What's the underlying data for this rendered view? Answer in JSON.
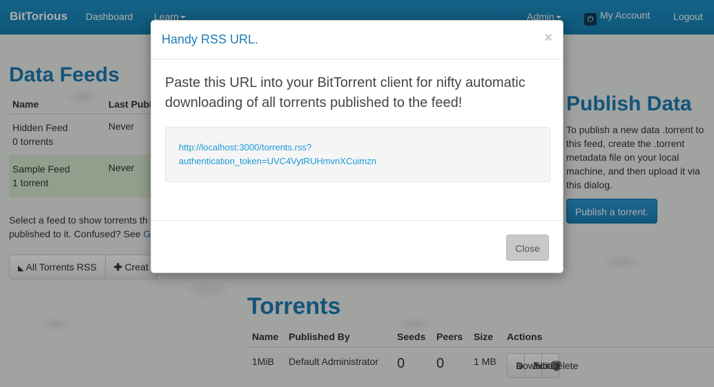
{
  "navbar": {
    "brand": "BitTorious",
    "dashboard": "Dashboard",
    "learn": "Learn",
    "admin": "Admin",
    "my_account": "My Account",
    "logout": "Logout"
  },
  "data_feeds": {
    "title": "Data Feeds",
    "columns": [
      "Name",
      "Last Publ"
    ],
    "rows": [
      {
        "name": "Hidden Feed",
        "count": "0 torrents",
        "last": "Never"
      },
      {
        "name": "Sample Feed",
        "count": "1 torrent",
        "last": "Never"
      }
    ],
    "help_line1": "Select a feed to show torrents th",
    "help_line2": "published to it. Confused? See ",
    "help_link": "G",
    "btn_rss": "All Torrents RSS",
    "btn_create": "Creat"
  },
  "publish": {
    "title": "Publish Data",
    "text": "To publish a new data .torrent to this feed, create the .torrent metadata file on your local machine, and then upload it via this dialog.",
    "button": "Publish a torrent."
  },
  "torrents": {
    "title": "Torrents",
    "columns": [
      "Name",
      "Published By",
      "Seeds",
      "Peers",
      "Size",
      "Actions"
    ],
    "rows": [
      {
        "name": "1MiB",
        "published_by": "Default Administrator",
        "seeds": "0",
        "peers": "0",
        "size": "1 MB"
      }
    ],
    "actions": {
      "download": "Download",
      "edit": "Edit",
      "delete": "Delete"
    }
  },
  "modal": {
    "title": "Handy RSS URL.",
    "close_x": "×",
    "lead": "Paste this URL into your BitTorrent client for nifty automatic downloading of all torrents published to the feed!",
    "url_line1": "http://localhost:3000/torrents.rss?",
    "url_line2": "authentication_token=UVC4VytRUHmvnXCuimzn",
    "close_button": "Close"
  }
}
